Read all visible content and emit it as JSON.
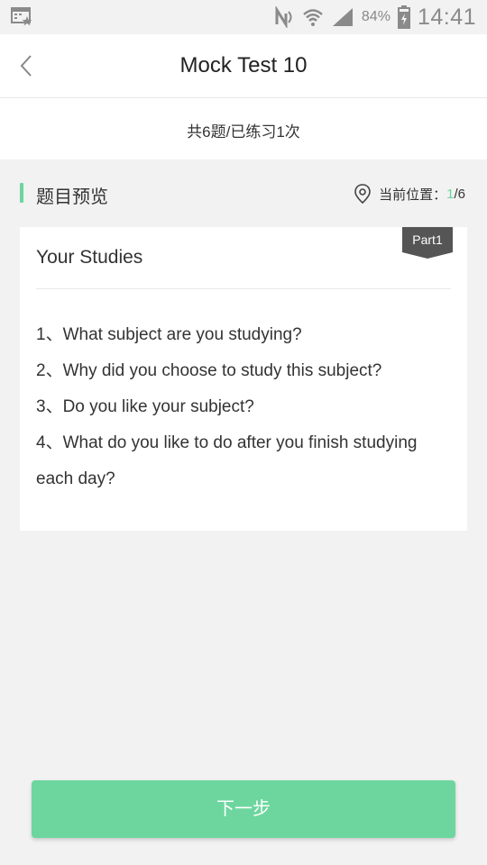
{
  "status": {
    "battery_pct": "84%",
    "time": "14:41"
  },
  "header": {
    "title": "Mock Test 10"
  },
  "summary": {
    "info": "共6题/已练习1次"
  },
  "section": {
    "title": "题目预览",
    "position_label": "当前位置：",
    "position_current": "1",
    "position_total": "/6"
  },
  "card": {
    "part_tag": "Part1",
    "title": "Your Studies",
    "questions": [
      "1、What subject are you studying?",
      "2、Why did you choose to study this subject?",
      "3、Do you like your subject?",
      "4、What do you like to do after you finish studying each day?"
    ]
  },
  "footer": {
    "next_label": "下一步"
  },
  "colors": {
    "accent": "#6cd59e",
    "tag_bg": "#555555"
  }
}
